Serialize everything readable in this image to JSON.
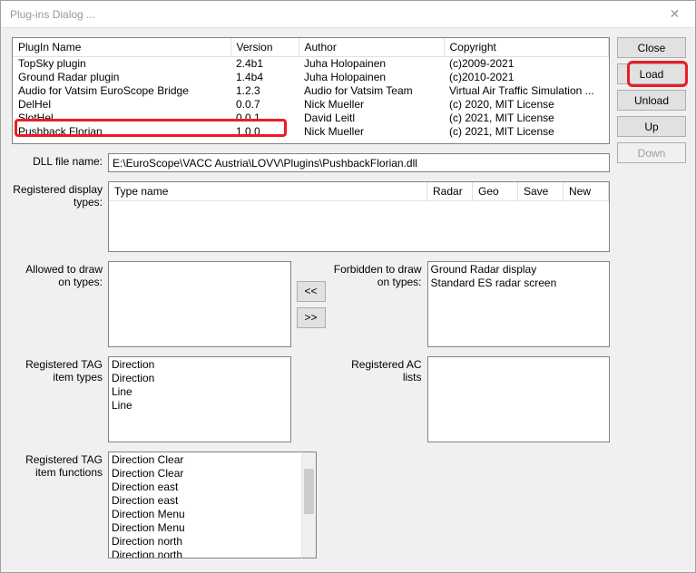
{
  "window": {
    "title": "Plug-ins Dialog ..."
  },
  "side_buttons": {
    "close": "Close",
    "load": "Load",
    "unload": "Unload",
    "up": "Up",
    "down": "Down"
  },
  "plugin_table": {
    "headers": {
      "name": "PlugIn Name",
      "version": "Version",
      "author": "Author",
      "copyright": "Copyright"
    },
    "rows": [
      {
        "name": "TopSky plugin",
        "version": "2.4b1",
        "author": "Juha Holopainen",
        "copyright": "(c)2009-2021"
      },
      {
        "name": "Ground Radar plugin",
        "version": "1.4b4",
        "author": "Juha Holopainen",
        "copyright": "(c)2010-2021"
      },
      {
        "name": "Audio for Vatsim EuroScope Bridge",
        "version": "1.2.3",
        "author": "Audio for Vatsim Team",
        "copyright": "Virtual Air Traffic Simulation ..."
      },
      {
        "name": "DelHel",
        "version": "0.0.7",
        "author": "Nick Mueller",
        "copyright": "(c) 2020, MIT License"
      },
      {
        "name": "SlotHel",
        "version": "0.0.1",
        "author": "David Leitl",
        "copyright": "(c) 2021, MIT License"
      },
      {
        "name": "Pushback Florian",
        "version": "1.0.0",
        "author": "Nick Mueller",
        "copyright": "(c) 2021, MIT License"
      }
    ]
  },
  "labels": {
    "dll_file": "DLL file name:",
    "reg_display": "Registered display types:",
    "allowed_draw": "Allowed to draw on types:",
    "forbidden_draw": "Forbidden to draw on types:",
    "reg_tag_item": "Registered TAG item types",
    "reg_ac_lists": "Registered AC lists",
    "reg_tag_func": "Registered TAG item functions"
  },
  "dll_path": "E:\\EuroScope\\VACC Austria\\LOVV\\Plugins\\PushbackFlorian.dll",
  "display_types_headers": {
    "typename": "Type name",
    "radar": "Radar",
    "geo": "Geo",
    "save": "Save",
    "new": "New"
  },
  "move_btns": {
    "left": "<<",
    "right": ">>"
  },
  "forbidden_list": [
    "Ground Radar display",
    "Standard ES radar screen"
  ],
  "tag_item_types": [
    "Direction",
    "Direction",
    "Line",
    "Line"
  ],
  "tag_item_functions": [
    "Direction Clear",
    "Direction Clear",
    "Direction east",
    "Direction east",
    "Direction Menu",
    "Direction Menu",
    "Direction north",
    "Direction north"
  ]
}
